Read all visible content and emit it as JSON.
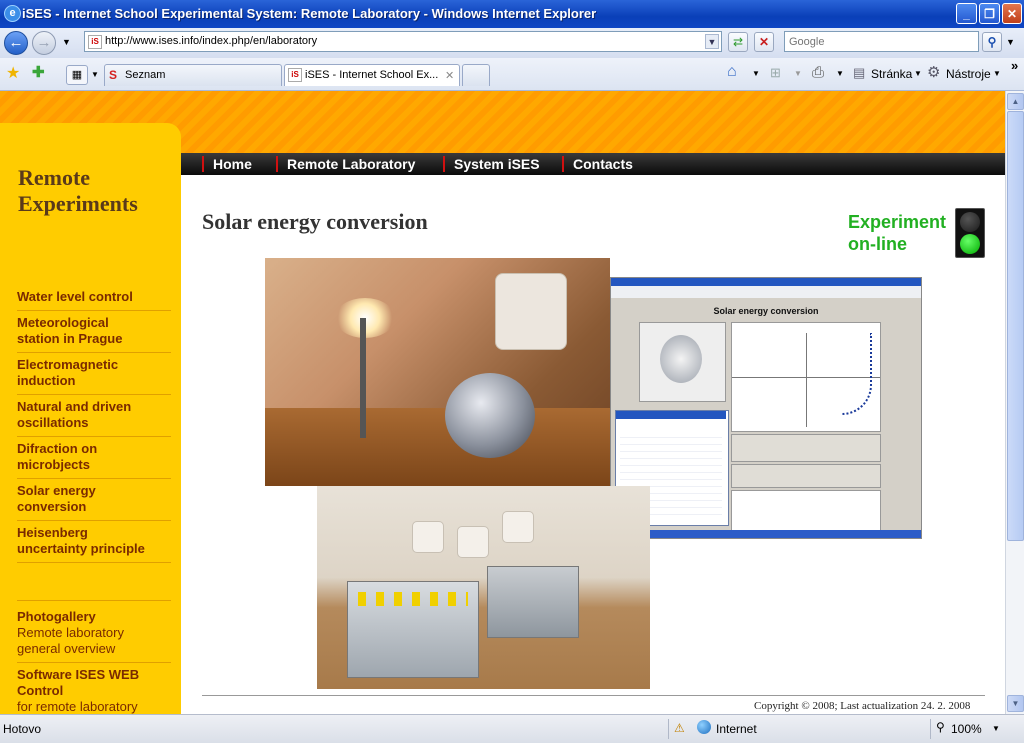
{
  "window": {
    "title": "iSES - Internet School Experimental System: Remote Laboratory - Windows Internet Explorer",
    "minimize": "_",
    "maximize": "❐",
    "close": "✕"
  },
  "toolbar": {
    "url": "http://www.ises.info/index.php/en/laboratory",
    "search_placeholder": "Google",
    "back": "←",
    "forward": "→",
    "refresh": "⇄",
    "stop": "✕",
    "search_go": "⚲"
  },
  "tabs": [
    {
      "label": "Seznam",
      "favicon": "S"
    },
    {
      "label": "iSES - Internet School Ex...",
      "close": "✕"
    }
  ],
  "commands": {
    "page": "Stránka",
    "tools": "Nástroje",
    "more": "»"
  },
  "sidebar": {
    "heading_line1": "Remote",
    "heading_line2": "Experiments",
    "items": [
      {
        "line1": "Water level control"
      },
      {
        "line1": "Meteorological",
        "line2": "station in Prague"
      },
      {
        "line1": "Electromagnetic",
        "line2": "induction"
      },
      {
        "line1": "Natural and driven",
        "line2": "oscillations"
      },
      {
        "line1": "Difraction on",
        "line2": "microbjects"
      },
      {
        "line1": "Solar energy",
        "line2": "conversion"
      },
      {
        "line1": "Heisenberg",
        "line2": "uncertainty principle"
      }
    ],
    "extra": [
      {
        "title": "Photogallery",
        "sub1": "Remote laboratory",
        "sub2": "general overview"
      },
      {
        "title": "Software ISES WEB",
        "title2": "Control",
        "sub1": "for remote laboratory"
      }
    ]
  },
  "topnav": [
    "Home",
    "Remote Laboratory",
    "System iSES",
    "Contacts"
  ],
  "content": {
    "title": "Solar energy conversion",
    "status_line1": "Experiment",
    "status_line2": "on-line",
    "screenshot_title": "Solar energy conversion",
    "copyright": "Copyright © 2008; Last actualization 24. 2. 2008"
  },
  "statusbar": {
    "left": "Hotovo",
    "zone": "Internet",
    "zoom": "100%"
  },
  "colors": {
    "accent_orange": "#ffa800",
    "sidebar_yellow": "#ffcc00",
    "status_green": "#22b022",
    "nav_dark": "#1a1a1a",
    "nav_separator": "#d01010"
  }
}
